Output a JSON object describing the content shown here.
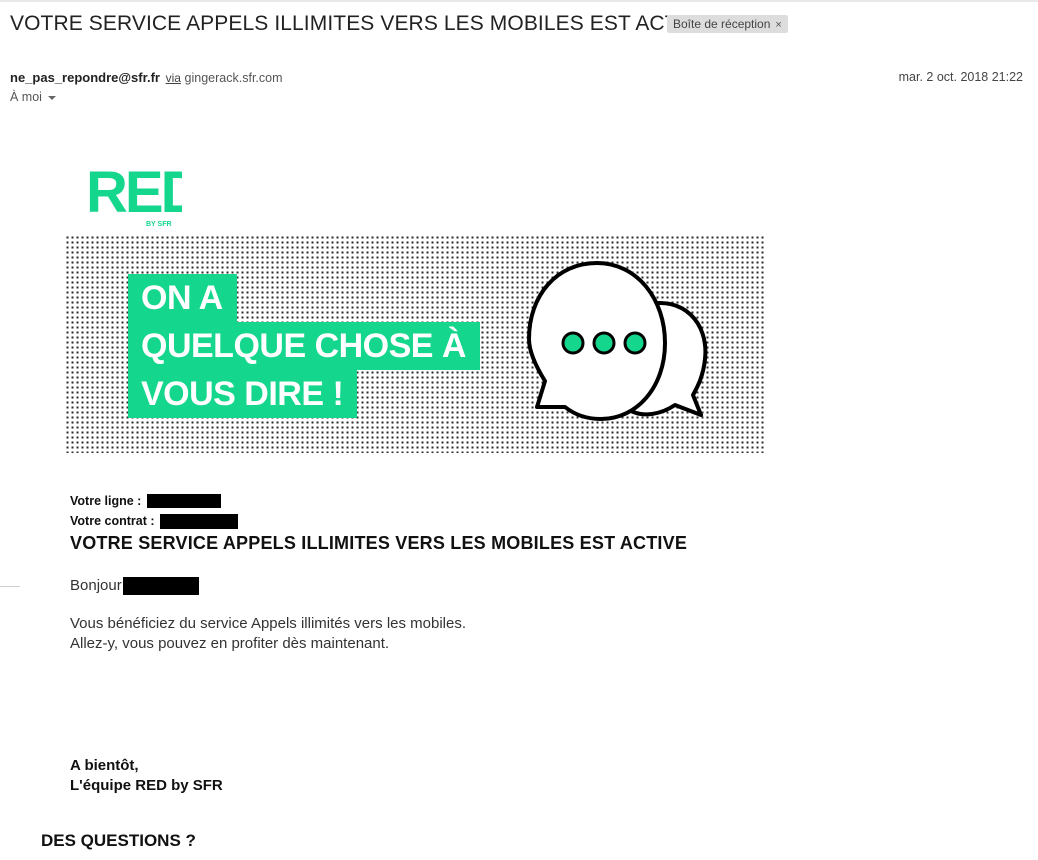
{
  "email": {
    "subject": "VOTRE SERVICE APPELS ILLIMITES VERS LES MOBILES EST ACTIVE",
    "label": "Boîte de réception",
    "label_close": "×",
    "sender_email": "ne_pas_repondre@sfr.fr",
    "via_text": "via",
    "via_domain": "gingerack.sfr.com",
    "date": "mar. 2 oct. 2018 21:22",
    "to": "À moi"
  },
  "logo": {
    "text": "RED",
    "sub": "BY SFR"
  },
  "banner": {
    "line1": "ON A",
    "line2": "QUELQUE CHOSE À",
    "line3": "VOUS DIRE !"
  },
  "body": {
    "line_label": "Votre ligne :",
    "contract_label": "Votre contrat :",
    "title": "VOTRE SERVICE APPELS ILLIMITES VERS LES MOBILES EST ACTIVE",
    "greeting": "Bonjour",
    "para1": "Vous bénéficiez du service Appels illimités vers les mobiles.",
    "para2": "Allez-y, vous pouvez en profiter dès maintenant.",
    "sign1": "A bientôt,",
    "sign2": "L'équipe RED by SFR",
    "questions": "DES QUESTIONS ?"
  },
  "colors": {
    "brand_green": "#15d68d",
    "text": "#222222"
  }
}
